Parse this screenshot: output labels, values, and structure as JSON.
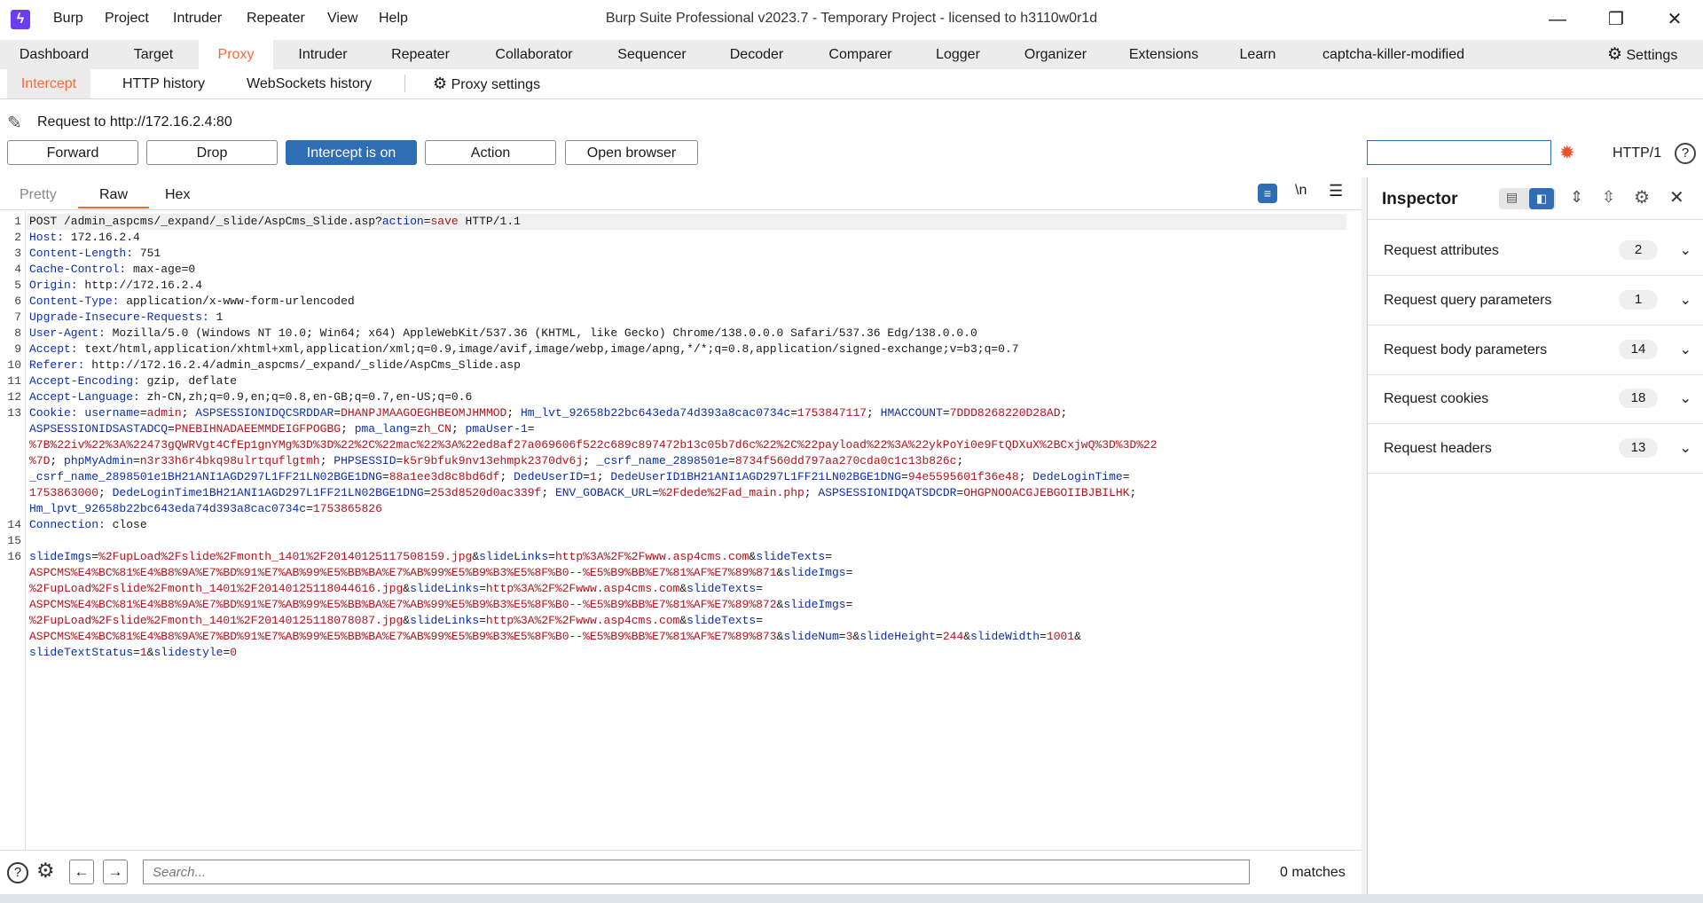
{
  "titlebar": {
    "menu": [
      "Burp",
      "Project",
      "Intruder",
      "Repeater",
      "View",
      "Help"
    ],
    "title": "Burp Suite Professional v2023.7 - Temporary Project - licensed to h3110w0r1d"
  },
  "main_tabs": [
    "Dashboard",
    "Target",
    "Proxy",
    "Intruder",
    "Repeater",
    "Collaborator",
    "Sequencer",
    "Decoder",
    "Comparer",
    "Logger",
    "Organizer",
    "Extensions",
    "Learn",
    "captcha-killer-modified"
  ],
  "settings_label": "Settings",
  "sub_tabs": [
    "Intercept",
    "HTTP history",
    "WebSockets history"
  ],
  "proxy_settings_label": "Proxy settings",
  "request_target": "Request to http://172.16.2.4:80",
  "buttons": {
    "forward": "Forward",
    "drop": "Drop",
    "intercept": "Intercept is on",
    "action": "Action",
    "open_browser": "Open browser"
  },
  "http_version": "HTTP/1",
  "editor_tabs": [
    "Pretty",
    "Raw",
    "Hex"
  ],
  "newline_toggle": "\\n",
  "request_lines": [
    {
      "n": "1",
      "parts": [
        {
          "t": "POST /admin_aspcms/_expand/_slide/AspCms_Slide.asp?",
          "c": ""
        },
        {
          "t": "action",
          "c": "k"
        },
        {
          "t": "=",
          "c": ""
        },
        {
          "t": "save",
          "c": "v"
        },
        {
          "t": " HTTP/1.1",
          "c": ""
        }
      ]
    },
    {
      "n": "2",
      "parts": [
        {
          "t": "Host:",
          "c": "k"
        },
        {
          "t": " 172.16.2.4",
          "c": ""
        }
      ]
    },
    {
      "n": "3",
      "parts": [
        {
          "t": "Content-Length:",
          "c": "k"
        },
        {
          "t": " 751",
          "c": ""
        }
      ]
    },
    {
      "n": "4",
      "parts": [
        {
          "t": "Cache-Control:",
          "c": "k"
        },
        {
          "t": " max-age=0",
          "c": ""
        }
      ]
    },
    {
      "n": "5",
      "parts": [
        {
          "t": "Origin:",
          "c": "k"
        },
        {
          "t": " http://172.16.2.4",
          "c": ""
        }
      ]
    },
    {
      "n": "6",
      "parts": [
        {
          "t": "Content-Type:",
          "c": "k"
        },
        {
          "t": " application/x-www-form-urlencoded",
          "c": ""
        }
      ]
    },
    {
      "n": "7",
      "parts": [
        {
          "t": "Upgrade-Insecure-Requests:",
          "c": "k"
        },
        {
          "t": " 1",
          "c": ""
        }
      ]
    },
    {
      "n": "8",
      "parts": [
        {
          "t": "User-Agent:",
          "c": "k"
        },
        {
          "t": " Mozilla/5.0 (Windows NT 10.0; Win64; x64) AppleWebKit/537.36 (KHTML, like Gecko) Chrome/138.0.0.0 Safari/537.36 Edg/138.0.0.0",
          "c": ""
        }
      ]
    },
    {
      "n": "9",
      "parts": [
        {
          "t": "Accept:",
          "c": "k"
        },
        {
          "t": " text/html,application/xhtml+xml,application/xml;q=0.9,image/avif,image/webp,image/apng,*/*;q=0.8,application/signed-exchange;v=b3;q=0.7",
          "c": ""
        }
      ]
    },
    {
      "n": "10",
      "parts": [
        {
          "t": "Referer:",
          "c": "k"
        },
        {
          "t": " http://172.16.2.4/admin_aspcms/_expand/_slide/AspCms_Slide.asp",
          "c": ""
        }
      ]
    },
    {
      "n": "11",
      "parts": [
        {
          "t": "Accept-Encoding:",
          "c": "k"
        },
        {
          "t": " gzip, deflate",
          "c": ""
        }
      ]
    },
    {
      "n": "12",
      "parts": [
        {
          "t": "Accept-Language:",
          "c": "k"
        },
        {
          "t": " zh-CN,zh;q=0.9,en;q=0.8,en-GB;q=0.7,en-US;q=0.6",
          "c": ""
        }
      ]
    },
    {
      "n": "13",
      "parts": [
        {
          "t": "Cookie:",
          "c": "k"
        },
        {
          "t": " ",
          "c": ""
        },
        {
          "t": "username",
          "c": "k"
        },
        {
          "t": "=",
          "c": ""
        },
        {
          "t": "admin",
          "c": "v"
        },
        {
          "t": "; ",
          "c": ""
        },
        {
          "t": "ASPSESSIONIDQCSRDDAR",
          "c": "k"
        },
        {
          "t": "=",
          "c": ""
        },
        {
          "t": "DHANPJMAAGOEGHBEOMJHMMOD",
          "c": "v"
        },
        {
          "t": "; ",
          "c": ""
        },
        {
          "t": "Hm_lvt_92658b22bc643eda74d393a8cac0734c",
          "c": "k"
        },
        {
          "t": "=",
          "c": ""
        },
        {
          "t": "1753847117",
          "c": "v"
        },
        {
          "t": "; ",
          "c": ""
        },
        {
          "t": "HMACCOUNT",
          "c": "k"
        },
        {
          "t": "=",
          "c": ""
        },
        {
          "t": "7DDD8268220D28AD",
          "c": "v"
        },
        {
          "t": ";",
          "c": ""
        }
      ]
    },
    {
      "n": "",
      "parts": [
        {
          "t": "ASPSESSIONIDSASTADCQ",
          "c": "k"
        },
        {
          "t": "=",
          "c": ""
        },
        {
          "t": "PNEBIHNADAEEMMDEIGFPOGBG",
          "c": "v"
        },
        {
          "t": "; ",
          "c": ""
        },
        {
          "t": "pma_lang",
          "c": "k"
        },
        {
          "t": "=",
          "c": ""
        },
        {
          "t": "zh_CN",
          "c": "v"
        },
        {
          "t": "; ",
          "c": ""
        },
        {
          "t": "pmaUser-1",
          "c": "k"
        },
        {
          "t": "=",
          "c": ""
        }
      ]
    },
    {
      "n": "",
      "parts": [
        {
          "t": "%7B%22iv%22%3A%22473gQWRVgt4CfEp1gnYMg%3D%3D%22%2C%22mac%22%3A%22ed8af27a069606f522c689c897472b13c05b7d6c%22%2C%22payload%22%3A%22ykPoYi0e9FtQDXuX%2BCxjwQ%3D%3D%22",
          "c": "v"
        }
      ]
    },
    {
      "n": "",
      "parts": [
        {
          "t": "%7D",
          "c": "v"
        },
        {
          "t": "; ",
          "c": ""
        },
        {
          "t": "phpMyAdmin",
          "c": "k"
        },
        {
          "t": "=",
          "c": ""
        },
        {
          "t": "n3r33h6r4bkq98ulrtquflgtmh",
          "c": "v"
        },
        {
          "t": "; ",
          "c": ""
        },
        {
          "t": "PHPSESSID",
          "c": "k"
        },
        {
          "t": "=",
          "c": ""
        },
        {
          "t": "k5r9bfuk9nv13ehmpk2370dv6j",
          "c": "v"
        },
        {
          "t": "; ",
          "c": ""
        },
        {
          "t": "_csrf_name_2898501e",
          "c": "k"
        },
        {
          "t": "=",
          "c": ""
        },
        {
          "t": "8734f560dd797aa270cda0c1c13b826c",
          "c": "v"
        },
        {
          "t": ";",
          "c": ""
        }
      ]
    },
    {
      "n": "",
      "parts": [
        {
          "t": "_csrf_name_2898501e1BH21ANI1AGD297L1FF21LN02BGE1DNG",
          "c": "k"
        },
        {
          "t": "=",
          "c": ""
        },
        {
          "t": "88a1ee3d8c8bd6df",
          "c": "v"
        },
        {
          "t": "; ",
          "c": ""
        },
        {
          "t": "DedeUserID",
          "c": "k"
        },
        {
          "t": "=",
          "c": ""
        },
        {
          "t": "1",
          "c": "v"
        },
        {
          "t": "; ",
          "c": ""
        },
        {
          "t": "DedeUserID1BH21ANI1AGD297L1FF21LN02BGE1DNG",
          "c": "k"
        },
        {
          "t": "=",
          "c": ""
        },
        {
          "t": "94e5595601f36e48",
          "c": "v"
        },
        {
          "t": "; ",
          "c": ""
        },
        {
          "t": "DedeLoginTime",
          "c": "k"
        },
        {
          "t": "=",
          "c": ""
        }
      ]
    },
    {
      "n": "",
      "parts": [
        {
          "t": "1753863000",
          "c": "v"
        },
        {
          "t": "; ",
          "c": ""
        },
        {
          "t": "DedeLoginTime1BH21ANI1AGD297L1FF21LN02BGE1DNG",
          "c": "k"
        },
        {
          "t": "=",
          "c": ""
        },
        {
          "t": "253d8520d0ac339f",
          "c": "v"
        },
        {
          "t": "; ",
          "c": ""
        },
        {
          "t": "ENV_GOBACK_URL",
          "c": "k"
        },
        {
          "t": "=",
          "c": ""
        },
        {
          "t": "%2Fdede%2Fad_main.php",
          "c": "v"
        },
        {
          "t": "; ",
          "c": ""
        },
        {
          "t": "ASPSESSIONIDQATSDCDR",
          "c": "k"
        },
        {
          "t": "=",
          "c": ""
        },
        {
          "t": "OHGPNOOACGJEBGOIIBJBILHK",
          "c": "v"
        },
        {
          "t": ";",
          "c": ""
        }
      ]
    },
    {
      "n": "",
      "parts": [
        {
          "t": "Hm_lpvt_92658b22bc643eda74d393a8cac0734c",
          "c": "k"
        },
        {
          "t": "=",
          "c": ""
        },
        {
          "t": "1753865826",
          "c": "v"
        }
      ]
    },
    {
      "n": "14",
      "parts": [
        {
          "t": "Connection:",
          "c": "k"
        },
        {
          "t": " close",
          "c": ""
        }
      ]
    },
    {
      "n": "15",
      "parts": []
    },
    {
      "n": "16",
      "parts": [
        {
          "t": "slideImgs",
          "c": "k"
        },
        {
          "t": "=",
          "c": ""
        },
        {
          "t": "%2FupLoad%2Fslide%2Fmonth_1401%2F20140125117508159.jpg",
          "c": "v"
        },
        {
          "t": "&",
          "c": ""
        },
        {
          "t": "slideLinks",
          "c": "k"
        },
        {
          "t": "=",
          "c": ""
        },
        {
          "t": "http%3A%2F%2Fwww.asp4cms.com",
          "c": "v"
        },
        {
          "t": "&",
          "c": ""
        },
        {
          "t": "slideTexts",
          "c": "k"
        },
        {
          "t": "=",
          "c": ""
        }
      ]
    },
    {
      "n": "",
      "parts": [
        {
          "t": "ASPCMS%E4%BC%81%E4%B8%9A%E7%BD%91%E7%AB%99%E5%BB%BA%E7%AB%99%E5%B9%B3%E5%8F%B0--%E5%B9%BB%E7%81%AF%E7%89%871",
          "c": "v"
        },
        {
          "t": "&",
          "c": ""
        },
        {
          "t": "slideImgs",
          "c": "k"
        },
        {
          "t": "=",
          "c": ""
        }
      ]
    },
    {
      "n": "",
      "parts": [
        {
          "t": "%2FupLoad%2Fslide%2Fmonth_1401%2F20140125118044616.jpg",
          "c": "v"
        },
        {
          "t": "&",
          "c": ""
        },
        {
          "t": "slideLinks",
          "c": "k"
        },
        {
          "t": "=",
          "c": ""
        },
        {
          "t": "http%3A%2F%2Fwww.asp4cms.com",
          "c": "v"
        },
        {
          "t": "&",
          "c": ""
        },
        {
          "t": "slideTexts",
          "c": "k"
        },
        {
          "t": "=",
          "c": ""
        }
      ]
    },
    {
      "n": "",
      "parts": [
        {
          "t": "ASPCMS%E4%BC%81%E4%B8%9A%E7%BD%91%E7%AB%99%E5%BB%BA%E7%AB%99%E5%B9%B3%E5%8F%B0--%E5%B9%BB%E7%81%AF%E7%89%872",
          "c": "v"
        },
        {
          "t": "&",
          "c": ""
        },
        {
          "t": "slideImgs",
          "c": "k"
        },
        {
          "t": "=",
          "c": ""
        }
      ]
    },
    {
      "n": "",
      "parts": [
        {
          "t": "%2FupLoad%2Fslide%2Fmonth_1401%2F20140125118078087.jpg",
          "c": "v"
        },
        {
          "t": "&",
          "c": ""
        },
        {
          "t": "slideLinks",
          "c": "k"
        },
        {
          "t": "=",
          "c": ""
        },
        {
          "t": "http%3A%2F%2Fwww.asp4cms.com",
          "c": "v"
        },
        {
          "t": "&",
          "c": ""
        },
        {
          "t": "slideTexts",
          "c": "k"
        },
        {
          "t": "=",
          "c": ""
        }
      ]
    },
    {
      "n": "",
      "parts": [
        {
          "t": "ASPCMS%E4%BC%81%E4%B8%9A%E7%BD%91%E7%AB%99%E5%BB%BA%E7%AB%99%E5%B9%B3%E5%8F%B0--%E5%B9%BB%E7%81%AF%E7%89%873",
          "c": "v"
        },
        {
          "t": "&",
          "c": ""
        },
        {
          "t": "slideNum",
          "c": "k"
        },
        {
          "t": "=",
          "c": ""
        },
        {
          "t": "3",
          "c": "v"
        },
        {
          "t": "&",
          "c": ""
        },
        {
          "t": "slideHeight",
          "c": "k"
        },
        {
          "t": "=",
          "c": ""
        },
        {
          "t": "244",
          "c": "v"
        },
        {
          "t": "&",
          "c": ""
        },
        {
          "t": "slideWidth",
          "c": "k"
        },
        {
          "t": "=",
          "c": ""
        },
        {
          "t": "1001",
          "c": "v"
        },
        {
          "t": "&",
          "c": ""
        }
      ]
    },
    {
      "n": "",
      "parts": [
        {
          "t": "slideTextStatus",
          "c": "k"
        },
        {
          "t": "=",
          "c": ""
        },
        {
          "t": "1",
          "c": "v"
        },
        {
          "t": "&",
          "c": ""
        },
        {
          "t": "slidestyle",
          "c": "k"
        },
        {
          "t": "=",
          "c": ""
        },
        {
          "t": "0",
          "c": "v"
        }
      ]
    }
  ],
  "inspector": {
    "title": "Inspector",
    "rows": [
      {
        "label": "Request attributes",
        "count": "2"
      },
      {
        "label": "Request query parameters",
        "count": "1"
      },
      {
        "label": "Request body parameters",
        "count": "14"
      },
      {
        "label": "Request cookies",
        "count": "18"
      },
      {
        "label": "Request headers",
        "count": "13"
      }
    ]
  },
  "search": {
    "placeholder": "Search...",
    "matches": "0 matches"
  },
  "colors": {
    "accent": "#ff6633",
    "primary_button": "#2f6eb4",
    "key": "#0b2fa8",
    "value": "#b0151b",
    "logo": "#6b3cf0"
  }
}
